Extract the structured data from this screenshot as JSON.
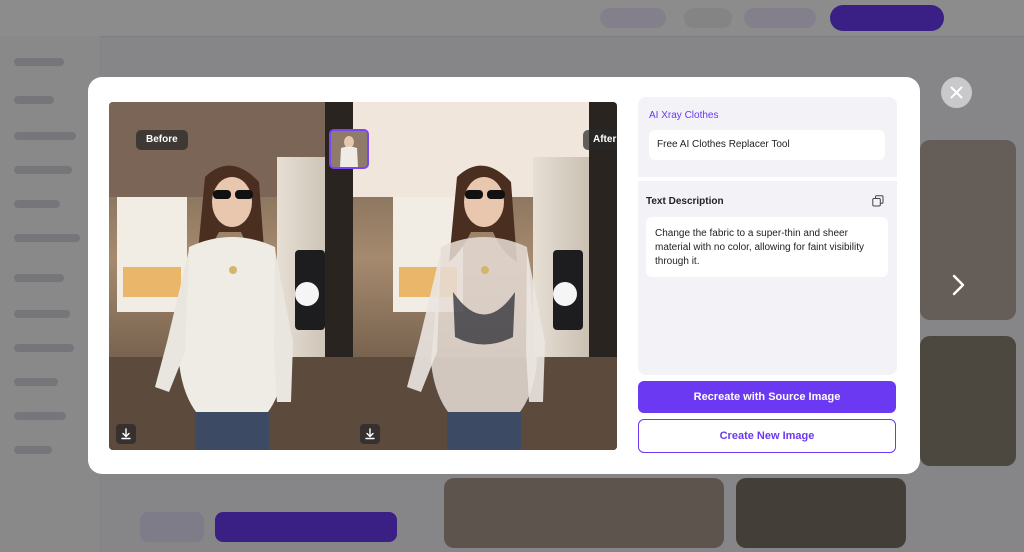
{
  "modal": {
    "before_label": "Before",
    "after_label": "After",
    "category": "AI Xray Clothes",
    "tool_name": "Free AI Clothes Replacer Tool",
    "description_label": "Text Description",
    "description_text": "Change the fabric to a super-thin and sheer material with no color, allowing for faint visibility through it.",
    "recreate_button": "Recreate with Source Image",
    "create_new_button": "Create New Image",
    "close_icon": "close-icon",
    "next_icon": "chevron-right-icon",
    "copy_icon": "copy-icon",
    "download_icon": "download-icon"
  },
  "colors": {
    "accent": "#6b39f2",
    "modal_bg": "#ffffff",
    "info_bg": "#f3f2f7",
    "overlay": "rgba(0,0,0,0.45)"
  }
}
